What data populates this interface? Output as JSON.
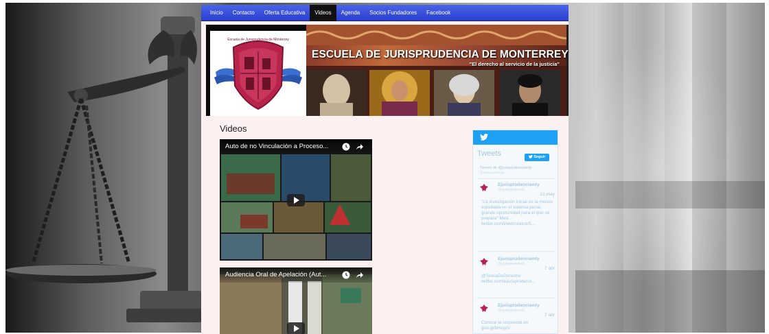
{
  "nav": {
    "items": [
      {
        "label": "Inicio"
      },
      {
        "label": "Contacto"
      },
      {
        "label": "Oferta Educativa"
      },
      {
        "label": "Videos",
        "active": true
      },
      {
        "label": "Agenda"
      },
      {
        "label": "Socios Fundadores"
      },
      {
        "label": "Facebook"
      }
    ]
  },
  "banner": {
    "title": "ESCUELA DE JURISPRUDENCIA DE MONTERREY",
    "subtitle": "\"El derecho al servicio de la justicia\"",
    "logo_text": "Escuela de Jurisprudencia de Monterrey"
  },
  "content": {
    "section_title": "Videos",
    "videos": [
      {
        "title": "Auto de no Vinculación a Proceso..."
      },
      {
        "title": "Audiencia Oral de Apelación (Aut..."
      }
    ]
  },
  "twitter": {
    "title": "Tweets",
    "follow_label": "Seguir",
    "by_line": "Tweets de @jurisprudenciamty",
    "by_handle": "@ejurisprudencia",
    "tweets": [
      {
        "name": "Ejurisprudenciamty",
        "handle": "@ejurisprudencia",
        "date": "21 may",
        "text": "\"La investigación inicial es la menos estudiada en el sistema penal, grande oportunidad para el que se prepara\" Mod... twitter.com/i/web/status/5..."
      },
      {
        "name": "Ejurisprudenciamty",
        "handle": "@ejurisprudencia",
        "date": "7 abr",
        "text": "@TeoriaDeDerecho twitter.com/ejurisprudenci..."
      },
      {
        "name": "Ejurisprudenciamty",
        "handle": "@ejurisprudencia",
        "date": "7 abr",
        "text": "Conoce la respuesta en goo.gl/bHcypV"
      }
    ]
  },
  "colors": {
    "nav_blue": "#2a3fd0",
    "twitter_blue": "#1da1f2",
    "page_bg": "#fdf0f0"
  }
}
